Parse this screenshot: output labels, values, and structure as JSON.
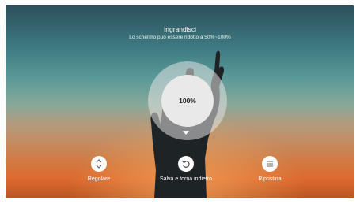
{
  "header": {
    "title": "Ingrandisci",
    "subtitle": "Lo schermo può essere ridotto a 50%~100%"
  },
  "dial": {
    "value_label": "100%",
    "zoom_percent": 100
  },
  "controls": [
    {
      "label": "Regolare",
      "icon": "up-down-arrows-icon"
    },
    {
      "label": "Salva e torna indietro",
      "icon": "undo-arrow-icon"
    },
    {
      "label": "Ripristina",
      "icon": "menu-lines-icon"
    }
  ]
}
